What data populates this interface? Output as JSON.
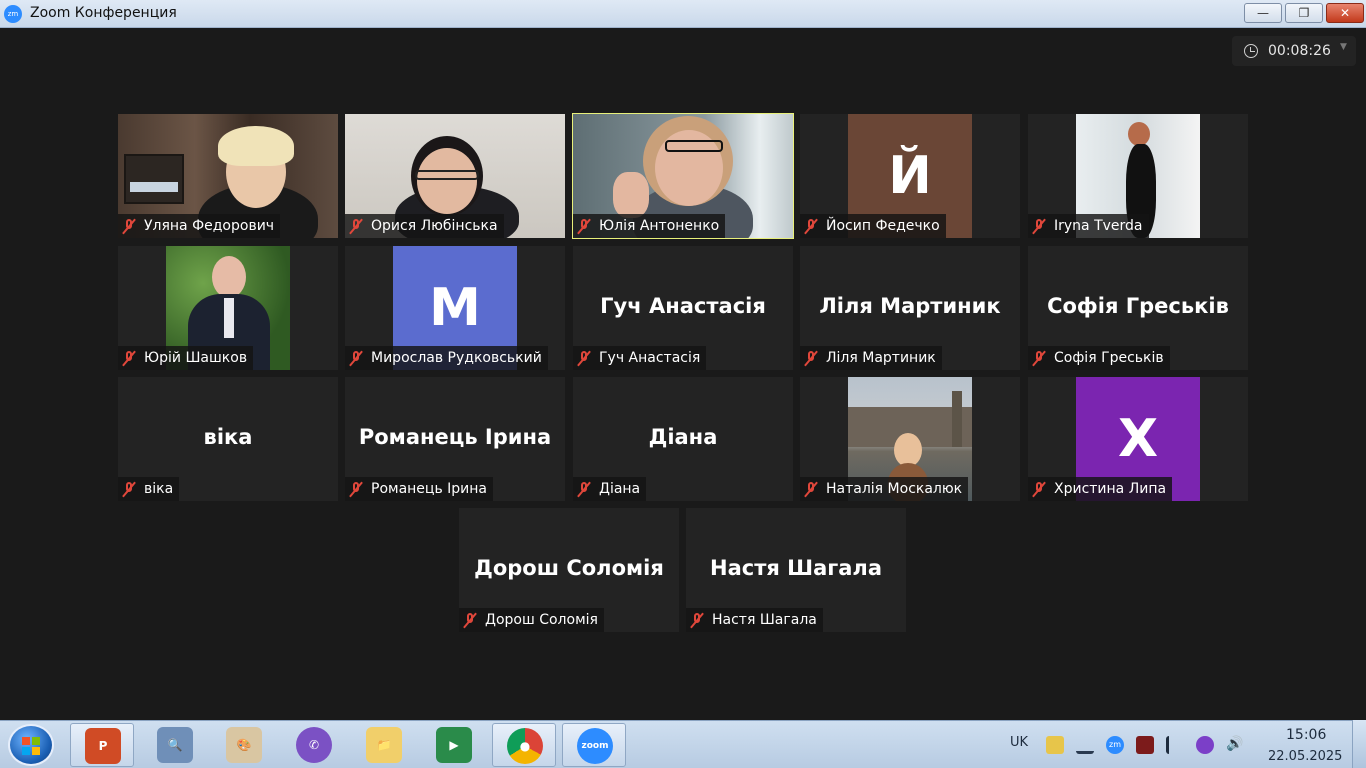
{
  "window": {
    "title": "Zoom Конференция",
    "app_icon": "zm",
    "min_label": "—",
    "max_label": "❐",
    "close_label": "✕"
  },
  "meeting": {
    "timer": "00:08:26"
  },
  "participants": [
    {
      "name": "Уляна Федорович",
      "type": "video",
      "scene": "office"
    },
    {
      "name": "Орися Любінська",
      "type": "video",
      "scene": "wall"
    },
    {
      "name": "Юлія Антоненко",
      "type": "video",
      "scene": "room",
      "active_speaker": true
    },
    {
      "name": "Йосип Федечко",
      "type": "avatar",
      "letter": "Й",
      "color": "#6a4636"
    },
    {
      "name": "Iryna Tverda",
      "type": "photo",
      "scene": "white"
    },
    {
      "name": "Юрій Шашков",
      "type": "photo",
      "scene": "green"
    },
    {
      "name": "Мирослав Рудковський",
      "type": "avatar",
      "letter": "М",
      "color": "#5b6ccf"
    },
    {
      "name": "Гуч Анастасія",
      "type": "name"
    },
    {
      "name": "Ліля Мартиник",
      "type": "name"
    },
    {
      "name": "Софія Греськів",
      "type": "name"
    },
    {
      "name": "віка",
      "type": "name"
    },
    {
      "name": "Романець Ірина",
      "type": "name"
    },
    {
      "name": "Діана",
      "type": "name"
    },
    {
      "name": "Наталія Москалюк",
      "type": "photo",
      "scene": "london"
    },
    {
      "name": "Христина Липа",
      "type": "avatar",
      "letter": "Х",
      "color": "#7b25b0"
    },
    {
      "name": "Дорош Соломія",
      "type": "name"
    },
    {
      "name": "Настя Шагала",
      "type": "name"
    }
  ],
  "taskbar": {
    "apps": [
      {
        "name": "powerpoint",
        "label": "P"
      },
      {
        "name": "magnifier",
        "label": "🔍"
      },
      {
        "name": "paint",
        "label": "🎨"
      },
      {
        "name": "viber",
        "label": "✆"
      },
      {
        "name": "explorer",
        "label": "📁"
      },
      {
        "name": "meet",
        "label": "▶"
      },
      {
        "name": "chrome",
        "label": "●"
      },
      {
        "name": "zoom",
        "label": "zoom"
      }
    ],
    "language": "UK",
    "zoom_tray": "zm",
    "time": "15:06",
    "date": "22.05.2025"
  },
  "colors": {
    "active_speaker_border": "#e8f07a",
    "muted_icon": "#e0473b",
    "tile_bg": "#232323",
    "zoom_blue": "#2d8cff"
  }
}
